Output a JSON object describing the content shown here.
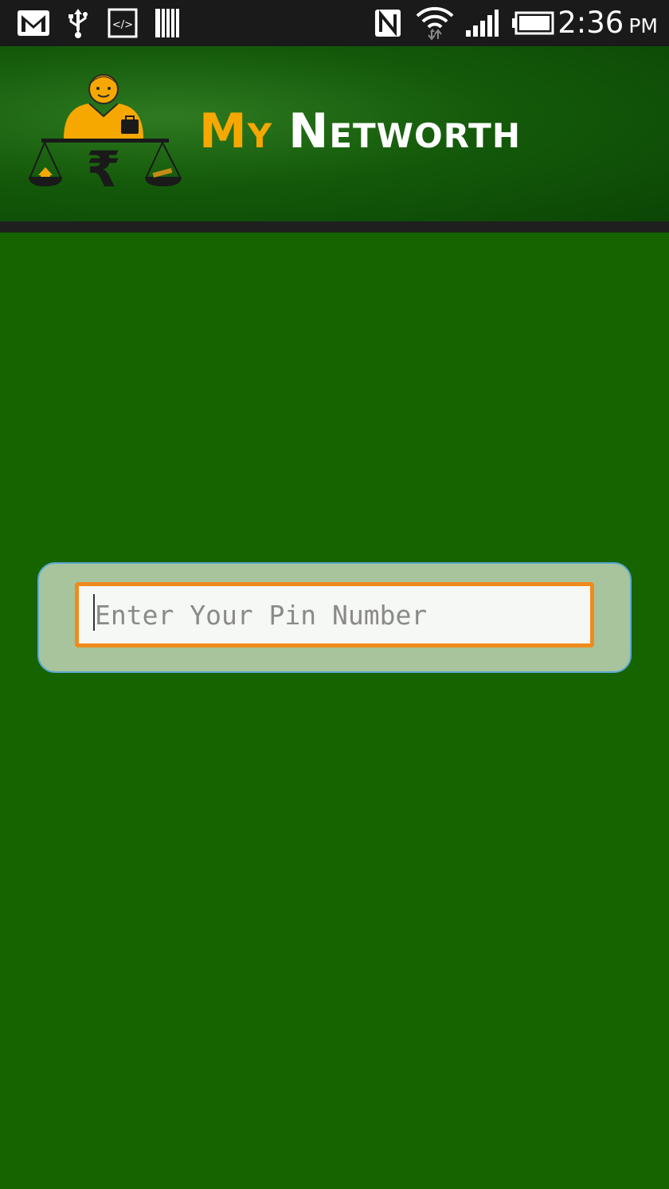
{
  "status_bar": {
    "time": "2:36",
    "ampm": "PM",
    "icons": [
      "gmail-icon",
      "usb-icon",
      "developer-mode-icon",
      "storage-icon",
      "nfc-icon",
      "wifi-icon",
      "signal-icon",
      "battery-icon"
    ]
  },
  "banner": {
    "title_part1": "My",
    "title_part2": "Networth",
    "logo": "person-with-rupee-scale-logo"
  },
  "pin": {
    "placeholder": "Enter Your Pin Number",
    "value": ""
  },
  "colors": {
    "background": "#156400",
    "accent_orange": "#f08a1c",
    "title_yellow": "#f7a800",
    "panel": "#a8c49d"
  }
}
